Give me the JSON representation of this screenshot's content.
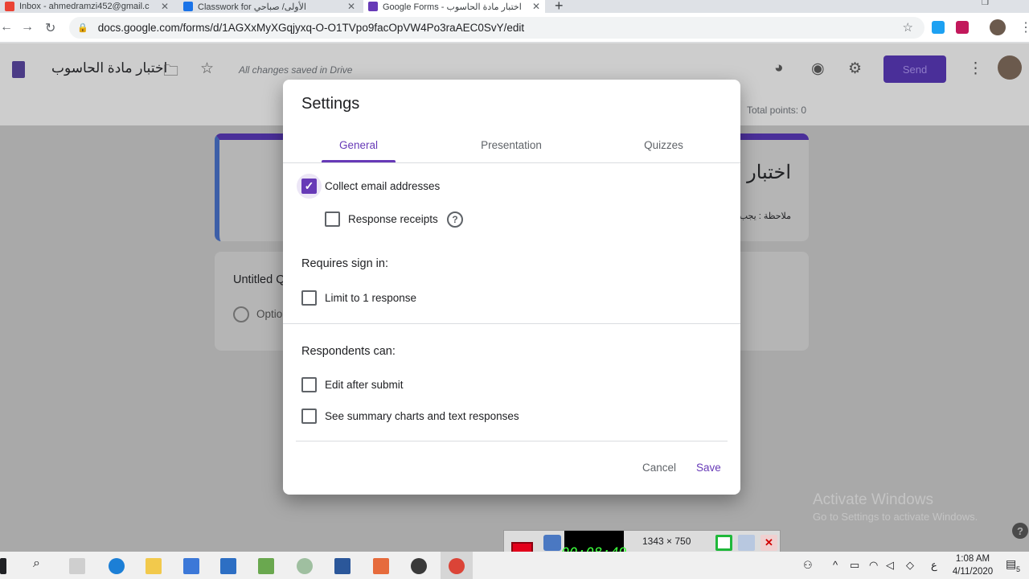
{
  "browser": {
    "tabs": [
      {
        "label": "Inbox - ahmedramzi452@gmail.c",
        "active": false
      },
      {
        "label": "Classwork for ‏الأولى/ صباحي",
        "active": false
      },
      {
        "label": "Google Forms - اختبار مادة الحاسوب",
        "active": true
      }
    ],
    "url": "docs.google.com/forms/d/1AGXxMyXGqjyxq-O-O1TVpo9facOpVW4Po3raAEC0SvY/edit"
  },
  "forms_header": {
    "form_title": "اختبار مادة الحاسوب",
    "saved_status": "All changes saved in Drive",
    "send_label": "Send",
    "total_points": "Total points: 0"
  },
  "form_body": {
    "card_title": "اختبار",
    "card_description": "ملاحظة : يجب",
    "question_title": "Untitled Q",
    "option_label": "Optio"
  },
  "settings_dialog": {
    "title": "Settings",
    "tabs": [
      "General",
      "Presentation",
      "Quizzes"
    ],
    "active_tab": "General",
    "collect_email": {
      "label": "Collect email addresses",
      "checked": true
    },
    "response_receipts": {
      "label": "Response receipts",
      "checked": false
    },
    "requires_sign_in_heading": "Requires sign in:",
    "limit_response": {
      "label": "Limit to 1 response",
      "checked": false
    },
    "respondents_can_heading": "Respondents can:",
    "edit_after_submit": {
      "label": "Edit after submit",
      "checked": false
    },
    "see_summary": {
      "label": "See summary charts and text responses",
      "checked": false
    },
    "cancel_label": "Cancel",
    "save_label": "Save"
  },
  "watermark": {
    "line1": "Activate Windows",
    "line2": "Go to Settings to activate Windows."
  },
  "recorder": {
    "timer": "00:08:49",
    "size": "1343 × 750"
  },
  "taskbar": {
    "time": "1:08 AM",
    "date": "4/11/2020",
    "lang": "ع",
    "notifications": "5"
  },
  "colors": {
    "accent": "#673ab7",
    "send_button": "#4a2f99"
  }
}
